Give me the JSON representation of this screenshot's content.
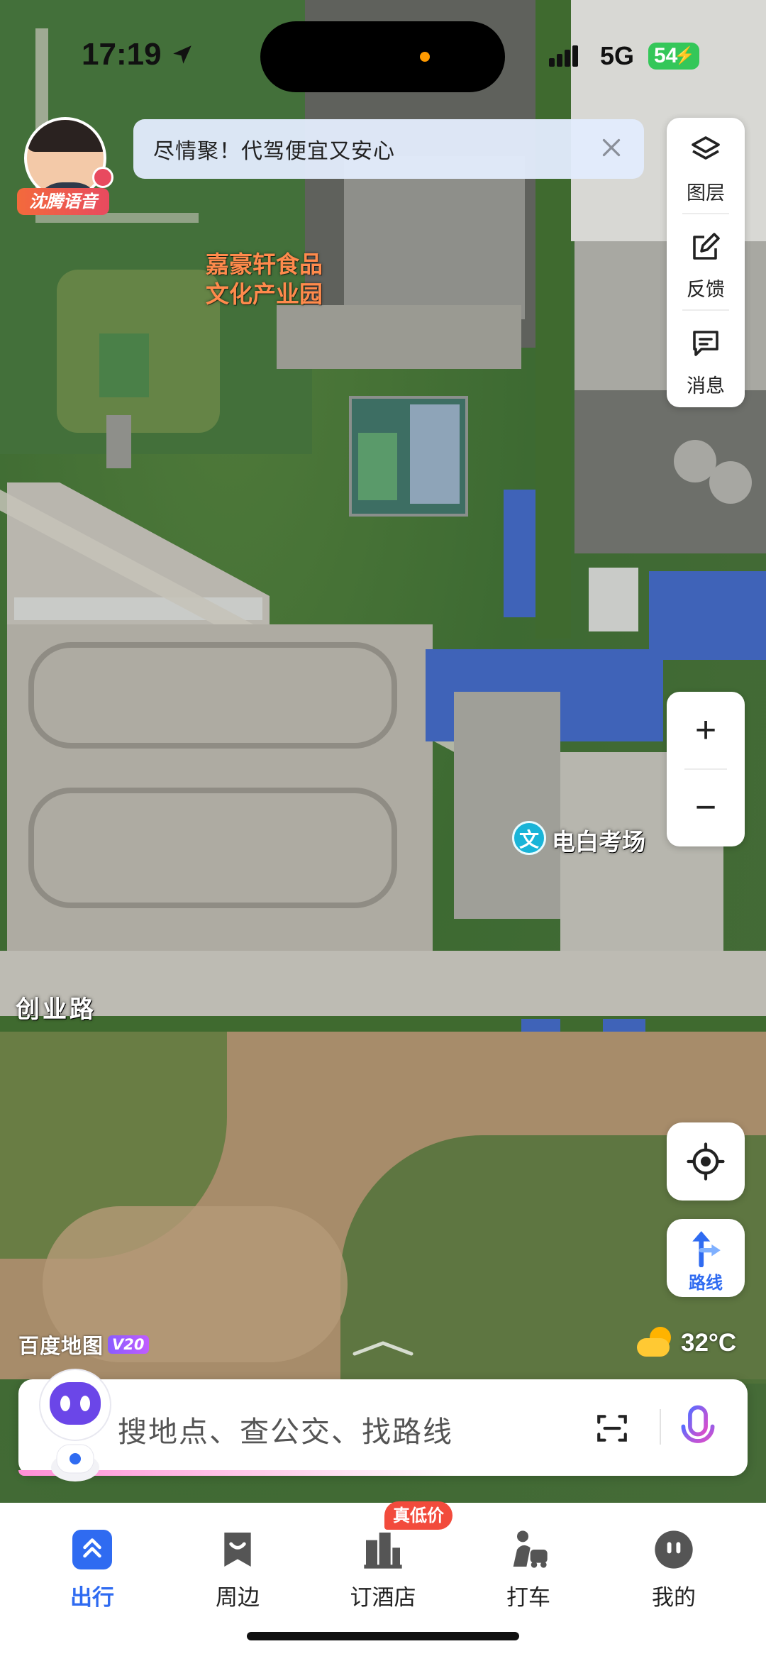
{
  "status_bar": {
    "time": "17:19",
    "network": "5G",
    "battery": "54"
  },
  "voice_pack": {
    "label": "沈腾语音"
  },
  "promo": {
    "text": "尽情聚！代驾便宜又安心"
  },
  "map_tools": [
    {
      "label": "图层",
      "icon": "layers-icon"
    },
    {
      "label": "反馈",
      "icon": "feedback-icon"
    },
    {
      "label": "消息",
      "icon": "message-icon"
    }
  ],
  "map_labels": {
    "area_line1": "嘉豪轩食品",
    "area_line2": "文化产业园",
    "poi_badge": "文",
    "poi_name": "电白考场",
    "road": "创业路"
  },
  "zoom": {
    "in": "+",
    "out": "−"
  },
  "route_button": {
    "label": "路线"
  },
  "brand": {
    "name": "百度地图",
    "version": "V20"
  },
  "weather": {
    "temperature": "32°C",
    "icon": "sun-cloud-icon"
  },
  "search": {
    "placeholder": "搜地点、查公交、找路线"
  },
  "tabs": [
    {
      "label": "出行",
      "active": true
    },
    {
      "label": "周边",
      "active": false
    },
    {
      "label": "订酒店",
      "active": false
    },
    {
      "label": "打车",
      "active": false
    },
    {
      "label": "我的",
      "active": false
    }
  ],
  "hotel_tag": "真低价",
  "colors": {
    "accent": "#2f6bf1",
    "poi_area": "#ff8a4c",
    "poi_pin": "#19b4d8",
    "deal_tag": "#f24b3c",
    "battery": "#34c759"
  }
}
